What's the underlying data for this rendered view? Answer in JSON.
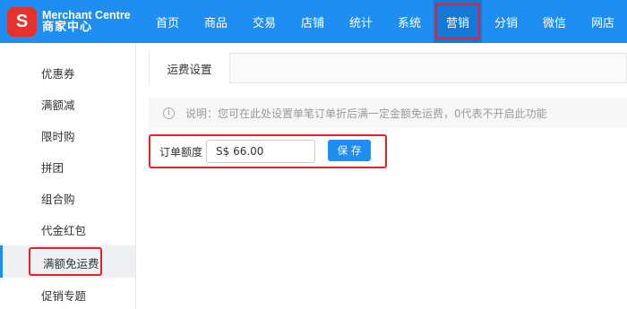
{
  "brand": {
    "badge": "S",
    "name_en": "Merchant Centre",
    "name_cn": "商家中心",
    "badge_color": "#e5322d",
    "accent_color": "#1e8ef3",
    "highlight_color": "#e8202a"
  },
  "nav": {
    "items": [
      {
        "label": "首页"
      },
      {
        "label": "商品"
      },
      {
        "label": "交易"
      },
      {
        "label": "店铺"
      },
      {
        "label": "统计"
      },
      {
        "label": "系统"
      },
      {
        "label": "营销",
        "active": true
      },
      {
        "label": "分销"
      },
      {
        "label": "微信"
      },
      {
        "label": "网店"
      }
    ]
  },
  "sidebar": {
    "items": [
      {
        "label": "优惠券"
      },
      {
        "label": "满额减"
      },
      {
        "label": "限时购"
      },
      {
        "label": "拼团"
      },
      {
        "label": "组合购"
      },
      {
        "label": "代金红包"
      },
      {
        "label": "满额免运费",
        "active": true
      },
      {
        "label": "促销专题"
      }
    ]
  },
  "main": {
    "tab": "运费设置",
    "notice": "说明：您可在此处设置单笔订单折后满一定金额免运费，0代表不开启此功能",
    "info_icon": "info-icon",
    "form": {
      "label": "订单额度",
      "amount_value": "S$ 66.00",
      "save_label": "保 存"
    }
  }
}
